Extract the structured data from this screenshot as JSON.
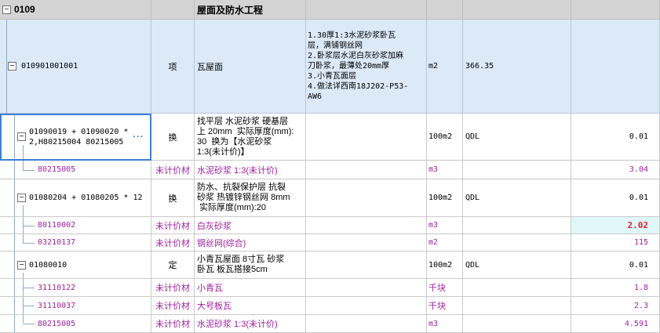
{
  "section": {
    "code": "0109",
    "title": "屋面及防水工程"
  },
  "main_item": {
    "code": "010901001001",
    "type": "项",
    "name": "瓦屋面",
    "features": "1.30厚1:3水泥砂浆卧瓦\n层，满铺钢丝网\n2.卧浆层水泥白灰砂浆加麻\n刀卧浆，最薄处20mm厚\n3.小青瓦面层\n4.做法详西南18J202-P53-\nAW6",
    "unit": "m2",
    "qty": "366.35"
  },
  "rows": [
    {
      "code": "01090019 + 01090020 *\n2,H80215004 80215005",
      "type": "换",
      "name": "找平层 水泥砂浆 硬基层\n上 20mm  实际厚度(mm):\n30  换为【水泥砂浆\n1:3(未计价)】",
      "unit": "100m2",
      "qtyexp": "QDL",
      "qty": "0.01",
      "more": "···"
    },
    {
      "code": "80215005",
      "type": "未计价材",
      "name": "水泥砂浆 1:3(未计价)",
      "unit": "m3",
      "qtyexp": "",
      "qty": "3.04"
    },
    {
      "code": "01080204 + 01080205 * 12",
      "type": "换",
      "name": "防水、抗裂保护层 抗裂\n砂浆 热镀锌钢丝网 8mm\n 实际厚度(mm):20",
      "unit": "100m2",
      "qtyexp": "QDL",
      "qty": "0.01"
    },
    {
      "code": "80110002",
      "type": "未计价材",
      "name": "白灰砂浆",
      "unit": "m3",
      "qtyexp": "",
      "qty": "2.02"
    },
    {
      "code": "03210137",
      "type": "未计价材",
      "name": "钢丝网(综合)",
      "unit": "m2",
      "qtyexp": "",
      "qty": "115"
    },
    {
      "code": "01080010",
      "type": "定",
      "name": "小青瓦屋面 8寸瓦 砂浆\n卧瓦 板瓦搭接5cm",
      "unit": "100m2",
      "qtyexp": "QDL",
      "qty": "0.01"
    },
    {
      "code": "31110122",
      "type": "未计价材",
      "name": "小青瓦",
      "unit": "千块",
      "qtyexp": "",
      "qty": "1.8"
    },
    {
      "code": "31110037",
      "type": "未计价材",
      "name": "大号板瓦",
      "unit": "千块",
      "qtyexp": "",
      "qty": "2.3"
    },
    {
      "code": "80215005",
      "type": "未计价材",
      "name": "水泥砂浆 1:3(未计价)",
      "unit": "m3",
      "qtyexp": "",
      "qty": "4.591"
    }
  ],
  "tree_toggle_symbol": "−",
  "colors": {
    "section_bg": "#d4d4d4",
    "selected_bg": "#dce9f7",
    "purple_text": "#a020a0",
    "highlight_cell": "#e0f7f9",
    "highlight_text": "#e02020"
  }
}
